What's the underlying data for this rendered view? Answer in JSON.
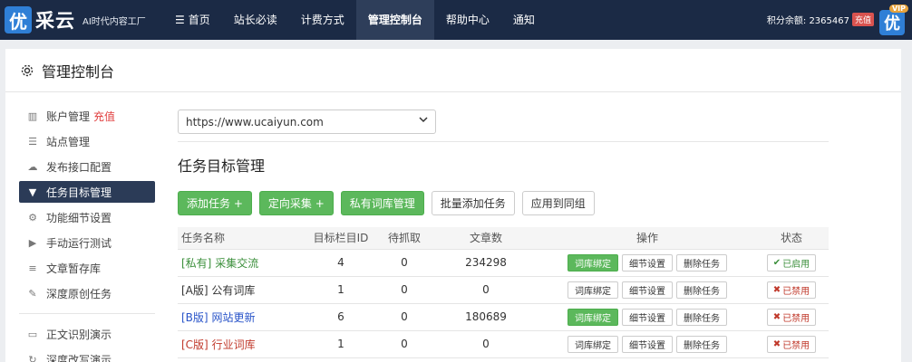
{
  "header": {
    "logo_badge": "优",
    "logo_name": "采云",
    "logo_sub": "AI时代内容工厂",
    "nav": [
      "首页",
      "站长必读",
      "计费方式",
      "管理控制台",
      "帮助中心",
      "通知"
    ],
    "nav_active_index": 3,
    "points_text": "积分余额: 2365467",
    "recharge_label": "充值",
    "avatar_char": "优",
    "vip_label": "VIP"
  },
  "panel": {
    "title": "管理控制台"
  },
  "sidebar": {
    "items": [
      {
        "label": "账户管理",
        "extra": "充值",
        "icon": "bar-chart-icon"
      },
      {
        "label": "站点管理",
        "icon": "list-icon"
      },
      {
        "label": "发布接口配置",
        "icon": "cloud-upload-icon"
      },
      {
        "label": "任务目标管理",
        "icon": "filter-icon",
        "active": true
      },
      {
        "label": "功能细节设置",
        "icon": "cogs-icon"
      },
      {
        "label": "手动运行测试",
        "icon": "play-icon"
      },
      {
        "label": "文章暂存库",
        "icon": "database-icon"
      },
      {
        "label": "深度原创任务",
        "icon": "edit-icon"
      },
      {
        "label": "正文识别演示",
        "icon": "monitor-icon"
      },
      {
        "label": "深度改写演示",
        "icon": "refresh-icon"
      }
    ]
  },
  "content": {
    "site_select_value": "https://www.ucaiyun.com",
    "section_title": "任务目标管理",
    "buttons": {
      "add_task": "添加任务 +",
      "directed_collect": "定向采集 +",
      "private_lexicon": "私有词库管理",
      "batch_add": "批量添加任务",
      "apply_group": "应用到同组"
    },
    "table": {
      "headers": [
        "任务名称",
        "目标栏目ID",
        "待抓取",
        "文章数",
        "操作",
        "状态"
      ],
      "rows": [
        {
          "prefix": "[私有]",
          "name": "采集交流",
          "color": "green",
          "column_id": "4",
          "pending": "0",
          "articles": "234298",
          "bind_active": true,
          "status": "已启用",
          "status_on": true
        },
        {
          "prefix": "[A版]",
          "name": "公有词库",
          "color": "black",
          "column_id": "1",
          "pending": "0",
          "articles": "0",
          "bind_active": false,
          "status": "已禁用",
          "status_on": false
        },
        {
          "prefix": "[B版]",
          "name": "网站更新",
          "color": "blue",
          "column_id": "6",
          "pending": "0",
          "articles": "180689",
          "bind_active": true,
          "status": "已禁用",
          "status_on": false
        },
        {
          "prefix": "[C版]",
          "name": "行业词库",
          "color": "red",
          "column_id": "1",
          "pending": "0",
          "articles": "0",
          "bind_active": false,
          "status": "已禁用",
          "status_on": false
        }
      ],
      "op_labels": {
        "bind": "词库绑定",
        "detail": "细节设置",
        "delete": "删除任务"
      }
    }
  }
}
